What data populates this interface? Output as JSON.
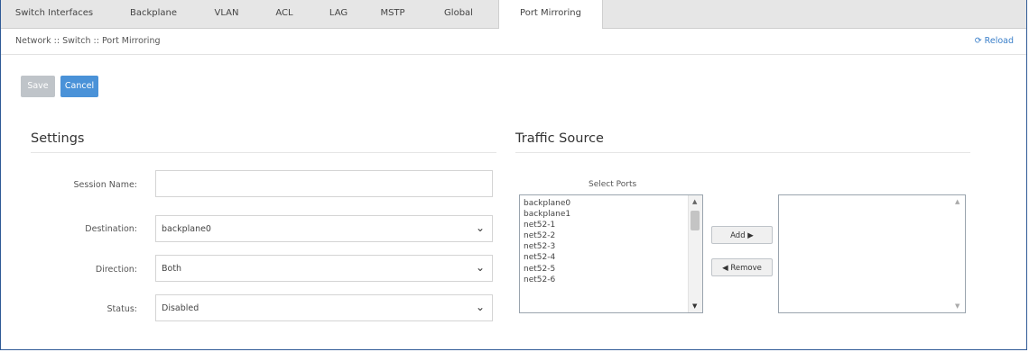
{
  "tabs": [
    {
      "label": "Switch Interfaces"
    },
    {
      "label": "Backplane"
    },
    {
      "label": "VLAN"
    },
    {
      "label": "ACL"
    },
    {
      "label": "LAG"
    },
    {
      "label": "MSTP"
    },
    {
      "label": "Global"
    },
    {
      "label": "Port Mirroring"
    }
  ],
  "breadcrumb": "Network :: Switch :: Port Mirroring",
  "reload_label": "Reload",
  "actions": {
    "save": "Save",
    "cancel": "Cancel"
  },
  "settings": {
    "heading": "Settings",
    "session_name": {
      "label": "Session Name:",
      "value": ""
    },
    "destination": {
      "label": "Destination:",
      "value": "backplane0"
    },
    "direction": {
      "label": "Direction:",
      "value": "Both"
    },
    "status": {
      "label": "Status:",
      "value": "Disabled"
    }
  },
  "traffic_source": {
    "heading": "Traffic Source",
    "select_ports_label": "Select Ports",
    "ports": [
      "backplane0",
      "backplane1",
      "net52-1",
      "net52-2",
      "net52-3",
      "net52-4",
      "net52-5",
      "net52-6"
    ],
    "add_label": "Add ▶",
    "remove_label": "◀ Remove"
  }
}
